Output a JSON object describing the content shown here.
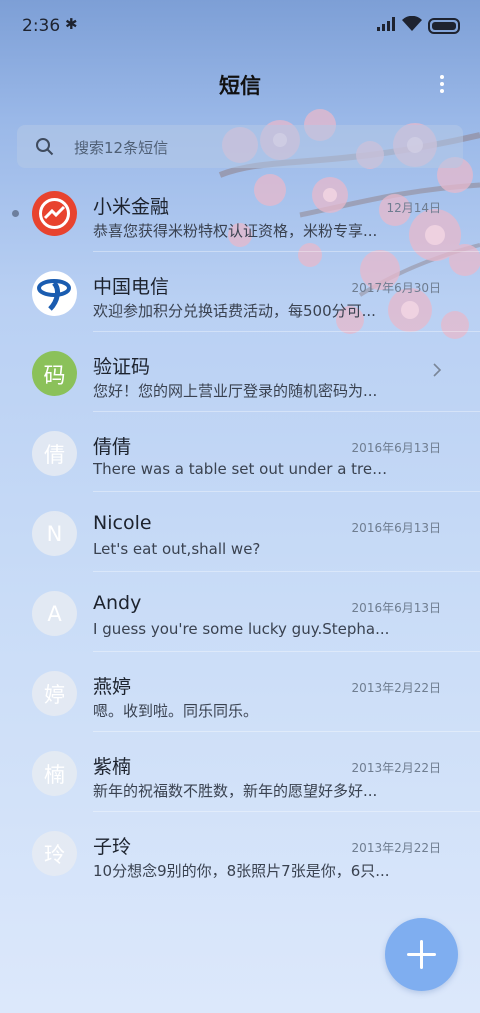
{
  "status_bar": {
    "time": "2:36"
  },
  "header": {
    "title": "短信"
  },
  "search": {
    "placeholder": "搜索12条短信"
  },
  "conversations": [
    {
      "name": "小米金融",
      "snippet": "恭喜您获得米粉特权认证资格，米粉专享...",
      "date": "12月14日",
      "avatar": "mi-finance-logo",
      "unread": true
    },
    {
      "name": "中国电信",
      "snippet": "欢迎参加积分兑换话费活动，每500分可...",
      "date": "2017年6月30日",
      "avatar": "china-telecom-logo"
    },
    {
      "name": "验证码",
      "snippet": "您好！您的网上营业厅登录的随机密码为...",
      "avatar_text": "码",
      "avatar_color": "#8bc15a",
      "has_chevron": true
    },
    {
      "name": "倩倩",
      "snippet": "There was a table set out under a tree i...",
      "date": "2016年6月13日",
      "avatar_text": "倩"
    },
    {
      "name": "Nicole",
      "snippet": "Let's eat out,shall we?",
      "date": "2016年6月13日",
      "avatar_text": "N"
    },
    {
      "name": "Andy",
      "snippet": "I guess you're some lucky guy.Stepha...",
      "date": "2016年6月13日",
      "avatar_text": "A"
    },
    {
      "name": "燕婷",
      "snippet": "嗯。收到啦。同乐同乐。",
      "date": "2013年2月22日",
      "avatar_text": "婷"
    },
    {
      "name": "紫楠",
      "snippet": "新年的祝福数不胜数，新年的愿望好多好...",
      "date": "2013年2月22日",
      "avatar_text": "楠"
    },
    {
      "name": "子玲",
      "snippet": "10分想念9别的你，8张照片7张是你，6只...",
      "date": "2013年2月22日",
      "avatar_text": "玲"
    }
  ],
  "fab": {
    "icon": "plus-icon",
    "color": "#7faef0"
  },
  "colors": {
    "accent": "#7faef0",
    "header_bg": "#7d9fd6"
  }
}
